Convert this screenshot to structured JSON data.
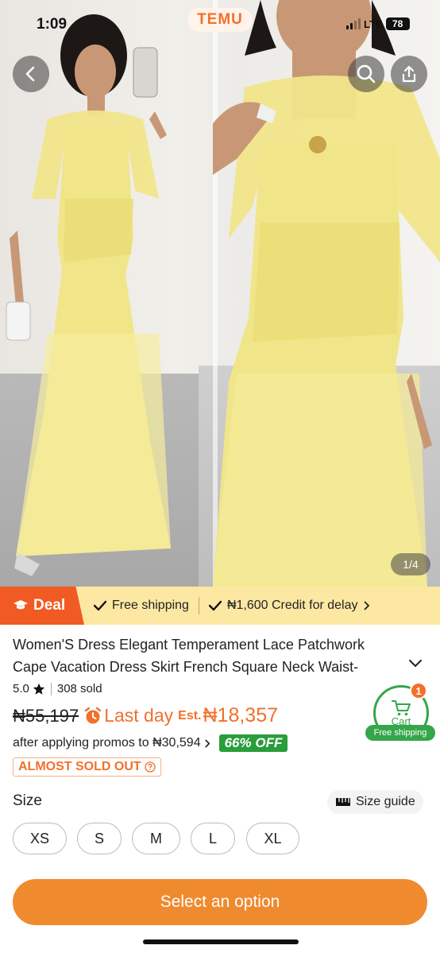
{
  "status_bar": {
    "time": "1:09",
    "network": "LTE",
    "battery": "78"
  },
  "header": {
    "brand": "TEMU"
  },
  "gallery": {
    "counter": "1/4"
  },
  "deal_bar": {
    "deal_label": "Deal",
    "free_shipping": "Free shipping",
    "credit": "₦1,600 Credit for delay"
  },
  "product": {
    "title": "Women'S Dress Elegant Temperament Lace Patchwork Cape Vacation Dress Skirt French Square Neck Waist-",
    "rating": "5.0",
    "sold": "308 sold",
    "old_price": "₦55,197",
    "last_day": "Last day",
    "est_label": "Est.",
    "est_price": "₦18,357",
    "promo_text": "after applying promos to ₦30,594",
    "discount_badge": "66% OFF",
    "stock_badge": "ALMOST SOLD OUT"
  },
  "cart": {
    "label": "Cart",
    "count": "1",
    "free_shipping": "Free shipping"
  },
  "size": {
    "label": "Size",
    "guide": "Size guide",
    "options": [
      "XS",
      "S",
      "M",
      "L",
      "XL"
    ]
  },
  "actions": {
    "select_option": "Select an option"
  },
  "colors": {
    "accent": "#f2702a",
    "green": "#35a64a",
    "deal_bg": "#fde8a3",
    "dress": "#f1e58a"
  }
}
